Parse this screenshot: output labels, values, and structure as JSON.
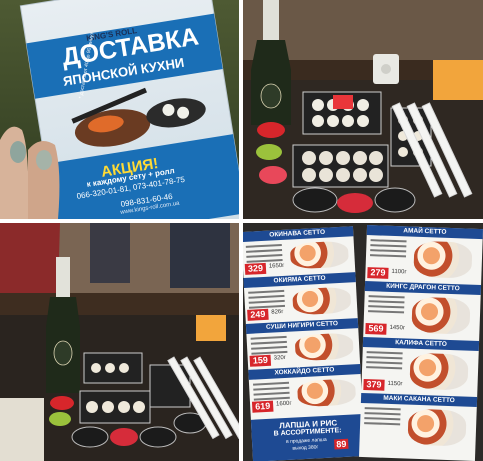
{
  "flyer": {
    "brand": "KING'S ROLL",
    "headline_1": "ДОСТАВКА",
    "headline_2": "ЯПОНСКОЙ КУХНИ",
    "small_note": "* доставка от 40 до 90 минут",
    "promo_title": "АКЦИЯ!",
    "promo_text": "к каждому сету + ролл",
    "phone_1": "066-320-01-81, 073-401-78-75",
    "phone_2": "098-831-60-46",
    "website": "www.kings-roll.com.ua"
  },
  "menu": {
    "left_page": [
      {
        "name": "ОКИНАВА СЕТТО",
        "price_new": "329",
        "price_old": "1650г"
      },
      {
        "name": "ОКИЯМА СЕТТО",
        "price_new": "249",
        "price_old": "826г"
      },
      {
        "name": "СУШИ НИГИРИ СЕТТО",
        "price_new": "159",
        "price_old": "320г"
      },
      {
        "name": "ХОККАЙДО СЕТТО",
        "price_new": "619",
        "price_old": "1600г"
      }
    ],
    "right_page": [
      {
        "name": "АМАЙ СЕТТО",
        "price_new": "279",
        "price_old": "1100г"
      },
      {
        "name": "КИНГС ДРАГОН СЕТТО",
        "price_new": "569",
        "price_old": "1450г"
      },
      {
        "name": "КАЛИФА СЕТТО",
        "price_new": "379",
        "price_old": "1150г"
      },
      {
        "name": "МАКИ САКАНА СЕТТО",
        "price_new": "",
        "price_old": ""
      }
    ],
    "banner_line_1": "ЛАПША И РИС",
    "banner_line_2": "В АССОРТИМЕНТЕ:",
    "banner_line_3": "в продаже лапша",
    "banner_line_4": "выход 380г",
    "banner_price": "89"
  },
  "colors": {
    "menu_header": "#1e4a93",
    "price_red": "#d7262b",
    "flyer_blue": "#1a6fb6",
    "bottle_green": "#1f2a1a",
    "wood": "#5a3d26"
  }
}
